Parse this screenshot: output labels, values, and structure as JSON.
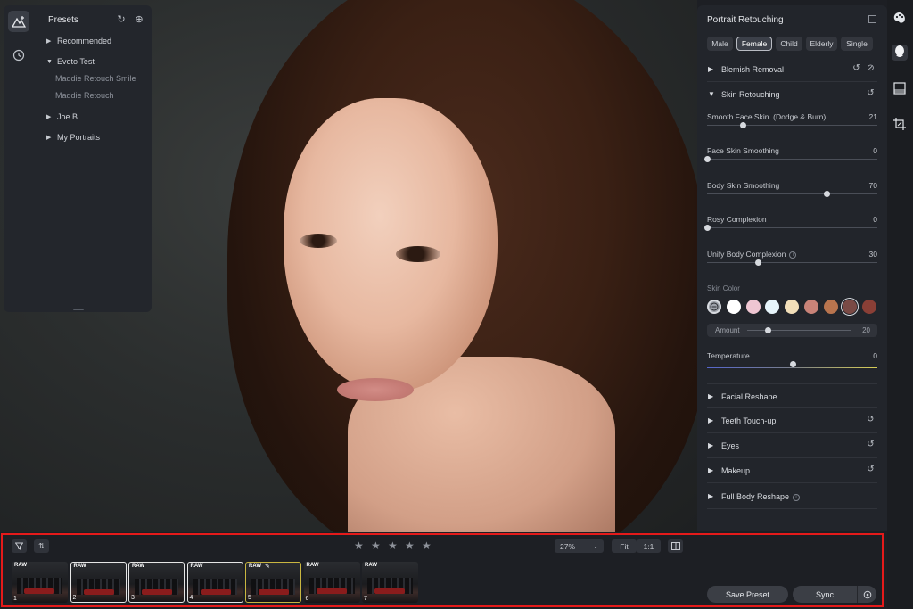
{
  "presets_panel": {
    "title": "Presets",
    "items": [
      {
        "label": "Recommended",
        "expanded": false
      },
      {
        "label": "Evoto Test",
        "expanded": true,
        "children": [
          "Maddie Retouch Smile",
          "Maddie Retouch"
        ]
      },
      {
        "label": "Joe B",
        "expanded": false
      },
      {
        "label": "My Portraits",
        "expanded": false
      }
    ]
  },
  "right_panel": {
    "title": "Portrait Retouching",
    "group_tabs": [
      "Male",
      "Female",
      "Child",
      "Elderly",
      "Single"
    ],
    "selected_tab": "Female",
    "sections": {
      "blemish_removal": "Blemish Removal",
      "skin_retouching": "Skin Retouching",
      "facial_reshape": "Facial Reshape",
      "teeth_touchup": "Teeth Touch-up",
      "eyes": "Eyes",
      "makeup": "Makeup",
      "full_body_reshape": "Full Body Reshape"
    },
    "sliders": [
      {
        "label": "Smooth Face Skin  (Dodge & Burn)",
        "value": "21",
        "fraction": 0.21
      },
      {
        "label": "Face Skin Smoothing",
        "value": "0",
        "fraction": 0.0
      },
      {
        "label": "Body Skin Smoothing",
        "value": "70",
        "fraction": 0.7
      },
      {
        "label": "Rosy Complexion",
        "value": "0",
        "fraction": 0.0
      },
      {
        "label": "Unify Body Complexion",
        "value": "30",
        "fraction": 0.3
      }
    ],
    "skin_color": {
      "label": "Skin Color",
      "swatches": [
        "#ffffff",
        "#efc6d2",
        "#e7f5fb",
        "#f2dfb9",
        "#c98378",
        "#b8744e",
        "#7a4a45",
        "#8a3f36"
      ],
      "selected_index": 6,
      "amount_label": "Amount",
      "amount_value": "20",
      "amount_fraction": 0.2
    },
    "temperature": {
      "label": "Temperature",
      "value": "0",
      "fraction": 0.5
    }
  },
  "bottom_bar": {
    "rating_stars": 5,
    "zoom": "27%",
    "fit_label": "Fit",
    "one_to_one_label": "1:1",
    "save_preset_label": "Save Preset",
    "sync_label": "Sync",
    "thumbnails": [
      {
        "badge": "RAW",
        "num": "1",
        "state": "normal"
      },
      {
        "badge": "RAW",
        "num": "2",
        "state": "selected"
      },
      {
        "badge": "RAW",
        "num": "3",
        "state": "selected"
      },
      {
        "badge": "RAW",
        "num": "4",
        "state": "selected"
      },
      {
        "badge": "RAW",
        "num": "5",
        "state": "current"
      },
      {
        "badge": "RAW",
        "num": "6",
        "state": "normal"
      },
      {
        "badge": "RAW",
        "num": "7",
        "state": "normal"
      }
    ]
  }
}
